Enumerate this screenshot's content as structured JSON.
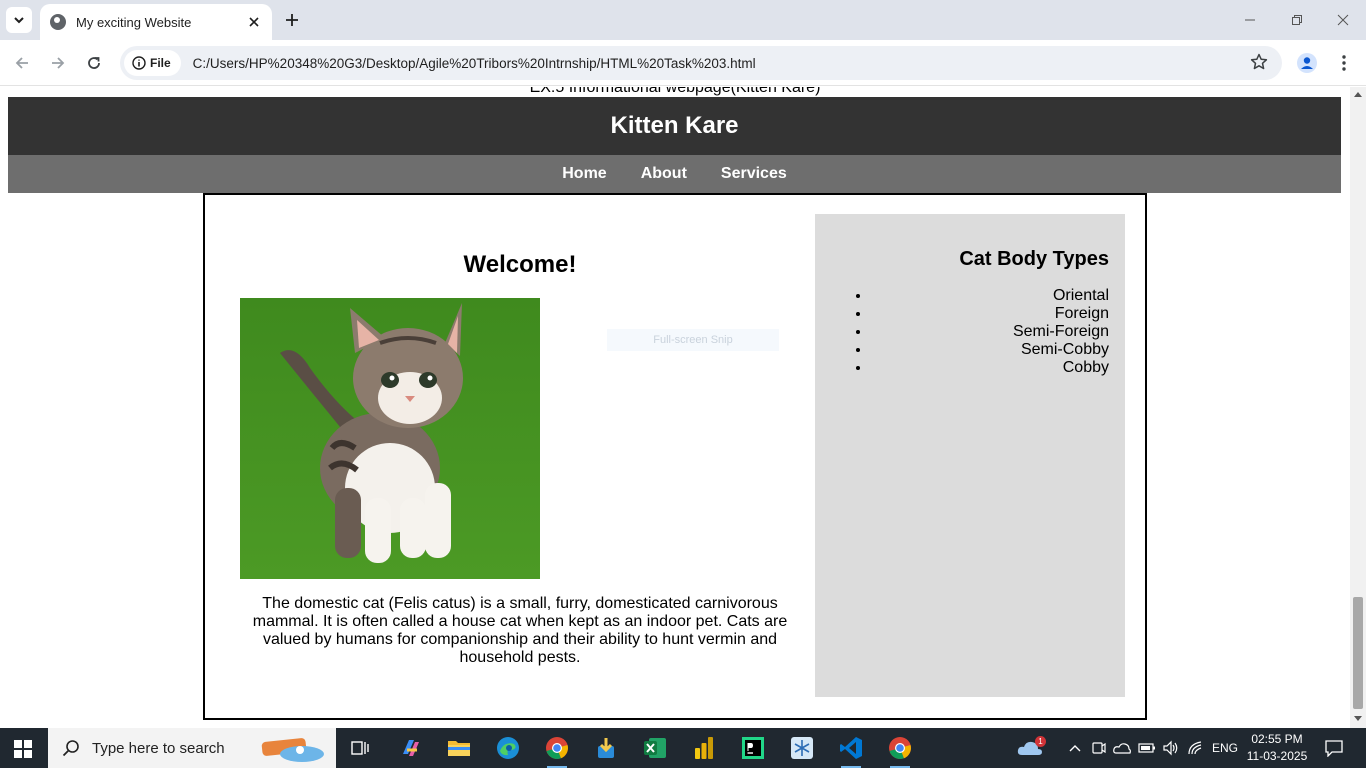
{
  "browser": {
    "tab_title": "My exciting Website",
    "chip_label": "File",
    "url": "C:/Users/HP%20348%20G3/Desktop/Agile%20Tribors%20Intrnship/HTML%20Task%203.html"
  },
  "page": {
    "caption": "EX:5 Informational webpage(Kitten Kare)",
    "site_title": "Kitten Kare",
    "nav": [
      "Home",
      "About",
      "Services"
    ],
    "welcome": "Welcome!",
    "snip_hint": "Full-screen Snip",
    "description": "The domestic cat (Felis catus) is a small, furry, domesticated carnivorous mammal. It is often called a house cat when kept as an indoor pet. Cats are valued by humans for companionship and their ability to hunt vermin and household pests.",
    "sidebar_title": "Cat Body Types",
    "body_types": [
      "Oriental",
      "Foreign",
      "Semi-Foreign",
      "Semi-Cobby",
      "Cobby"
    ]
  },
  "taskbar": {
    "search_placeholder": "Type here to search",
    "language": "ENG",
    "time": "02:55 PM",
    "date": "11-03-2025",
    "notification_count": "1",
    "apps": [
      "task-view",
      "copilot",
      "file-explorer",
      "edge",
      "chrome",
      "app-installer",
      "excel",
      "power-bi",
      "pycharm",
      "snipping-tool",
      "vscode",
      "chrome"
    ]
  },
  "colors": {
    "header_bg": "#333333",
    "nav_bg": "#6e6e6e",
    "sidebar_bg": "#dcdcdc",
    "taskbar_bg": "#202830"
  }
}
